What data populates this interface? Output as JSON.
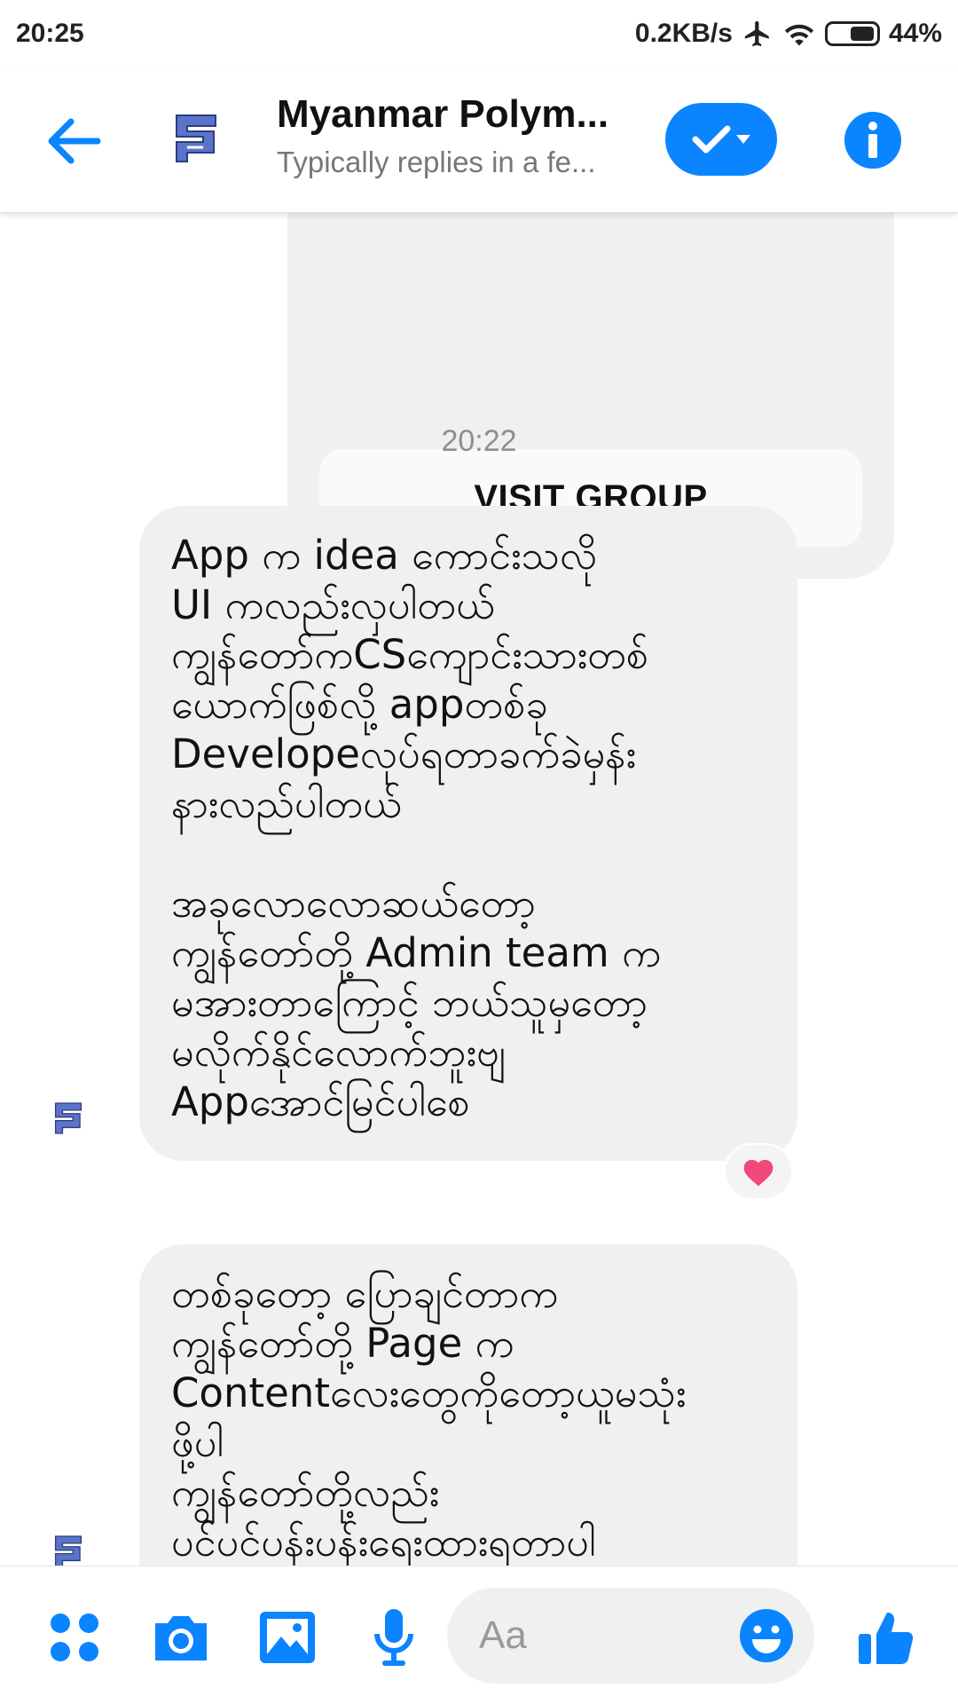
{
  "status_bar": {
    "time": "20:25",
    "network_speed": "0.2KB/s",
    "battery": "44%"
  },
  "header": {
    "title": "Myanmar Polym...",
    "subtitle": "Typically replies in a fe..."
  },
  "chat": {
    "visit_group_label": "VISIT GROUP",
    "timestamp": "20:22",
    "messages": [
      {
        "text": "App က idea ကောင်းသလို\nUI ကလည်းလှပါတယ်\nကျွန်တော်ကCSကျောင်းသားတစ်\nယောက်ဖြစ်လို့ appတစ်ခု\nDevelopeလုပ်ရတာခက်ခဲမှန်း\nနားလည်ပါတယ်\n\nအခုလောလောဆယ်တော့\nကျွန်တော်တို့ Admin team က\nမအားတာကြောင့် ဘယ်သူမှတော့\nမလိုက်နိုင်လောက်ဘူးဗျ\nAppအောင်မြင်ပါစေ",
        "reaction": "heart"
      },
      {
        "text": "တစ်ခုတော့ ပြောချင်တာက\nကျွန်တော်တို့ Page က\nContentလေးတွေကိုတော့ယူမသုံး\nဖို့ပါ\nကျွန်တော်တို့လည်း\nပင်ပင်ပန်းပန်းရေးထားရတာပါ"
      }
    ]
  },
  "composer": {
    "placeholder": "Aa"
  },
  "colors": {
    "accent": "#0a84ff",
    "bubble": "#f0f0f0",
    "reaction_heart": "#f0497a",
    "logo": "#5b74c9"
  }
}
